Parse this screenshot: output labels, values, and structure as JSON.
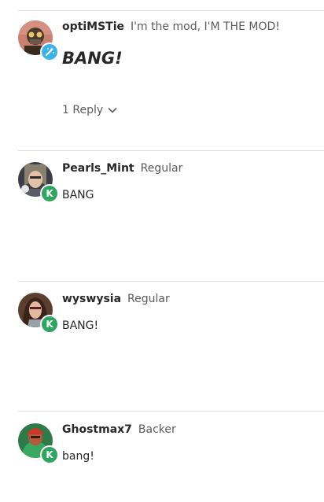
{
  "comments": [
    {
      "username": "optiMSTie",
      "tag": "I'm the mod, I'M THE MOD!",
      "body": "BANG!",
      "badge": "wand-icon",
      "replies_label": "1 Reply"
    },
    {
      "username": "Pearls_Mint",
      "tag": "Regular",
      "body": "BANG",
      "badge": "K"
    },
    {
      "username": "wyswysia",
      "tag": "Regular",
      "body": "BANG!",
      "badge": "K"
    },
    {
      "username": "Ghostmax7",
      "tag": "Backer",
      "body": "bang!",
      "badge": "K"
    }
  ],
  "colors": {
    "backer_badge": "#2ea65f",
    "mod_badge": "#3bb3e8",
    "divider": "#dcdede"
  }
}
